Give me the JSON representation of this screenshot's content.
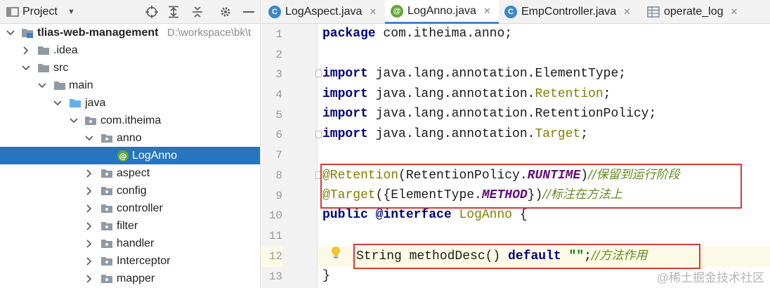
{
  "project_panel": {
    "title": "Project",
    "tree": [
      {
        "label": "tlias-web-management",
        "path": "D:\\workspace\\bk\\t",
        "icon": "module-folder-icon",
        "expanded": true,
        "bold": true
      },
      {
        "label": ".idea",
        "icon": "folder-icon",
        "expanded": false
      },
      {
        "label": "src",
        "icon": "folder-icon",
        "expanded": true
      },
      {
        "label": "main",
        "icon": "folder-icon",
        "expanded": true
      },
      {
        "label": "java",
        "icon": "source-folder-icon",
        "expanded": true
      },
      {
        "label": "com.itheima",
        "icon": "package-icon",
        "expanded": true
      },
      {
        "label": "anno",
        "icon": "package-icon",
        "expanded": true
      },
      {
        "label": "LogAnno",
        "icon": "annotation-icon",
        "selected": true
      },
      {
        "label": "aspect",
        "icon": "package-icon",
        "expanded": false
      },
      {
        "label": "config",
        "icon": "package-icon",
        "expanded": false
      },
      {
        "label": "controller",
        "icon": "package-icon",
        "expanded": false
      },
      {
        "label": "filter",
        "icon": "package-icon",
        "expanded": false
      },
      {
        "label": "handler",
        "icon": "package-icon",
        "expanded": false
      },
      {
        "label": "Interceptor",
        "icon": "package-icon",
        "expanded": false
      },
      {
        "label": "mapper",
        "icon": "package-icon",
        "expanded": false
      }
    ]
  },
  "editor": {
    "tabs": [
      {
        "label": "LogAspect.java",
        "icon": "class-icon",
        "icon_glyph": "C",
        "active": false
      },
      {
        "label": "LogAnno.java",
        "icon": "annotation-icon",
        "icon_glyph": "@",
        "active": true
      },
      {
        "label": "EmpController.java",
        "icon": "class-icon",
        "icon_glyph": "C",
        "active": false
      },
      {
        "label": "operate_log",
        "icon": "table-icon",
        "icon_glyph": "",
        "active": false
      }
    ],
    "line_numbers": [
      "1",
      "2",
      "3",
      "4",
      "5",
      "6",
      "7",
      "8",
      "9",
      "10",
      "11",
      "12",
      "13"
    ],
    "code": {
      "l1": {
        "kw": "package",
        "rest": " com.itheima.anno;"
      },
      "l3": {
        "kw": "import",
        "pre": " java.lang.annotation.",
        "name": "ElementType",
        "post": ";"
      },
      "l4": {
        "kw": "import",
        "pre": " java.lang.annotation.",
        "name": "Retention",
        "post": ";"
      },
      "l5": {
        "kw": "import",
        "pre": " java.lang.annotation.",
        "name": "RetentionPolicy",
        "post": ";"
      },
      "l6": {
        "kw": "import",
        "pre": " java.lang.annotation.",
        "name": "Target",
        "post": ";"
      },
      "l8": {
        "ann": "@Retention",
        "pre": "(RetentionPolicy.",
        "const": "RUNTIME",
        "post": ")",
        "comment": "//保留到运行阶段"
      },
      "l9": {
        "ann": "@Target",
        "pre": "({ElementType.",
        "const": "METHOD",
        "post": "})",
        "comment": "//标注在方法上"
      },
      "l10": {
        "kw1": "public",
        "kw2": "@interface",
        "name": "LogAnno",
        "post": " {"
      },
      "l12": {
        "pre": "String methodDesc() ",
        "kw": "default",
        "sp": " ",
        "str": "\"\"",
        "post": ";",
        "comment": "//方法作用"
      },
      "l13": {
        "text": "}"
      }
    },
    "current_line": "12"
  },
  "watermark": "@稀土掘金技术社区",
  "colors": {
    "keyword": "#000080",
    "annotation": "#808000",
    "constant": "#660e7a",
    "comment": "#628a1f",
    "selection": "#2675bf",
    "highlight_box": "#d83a3a"
  }
}
